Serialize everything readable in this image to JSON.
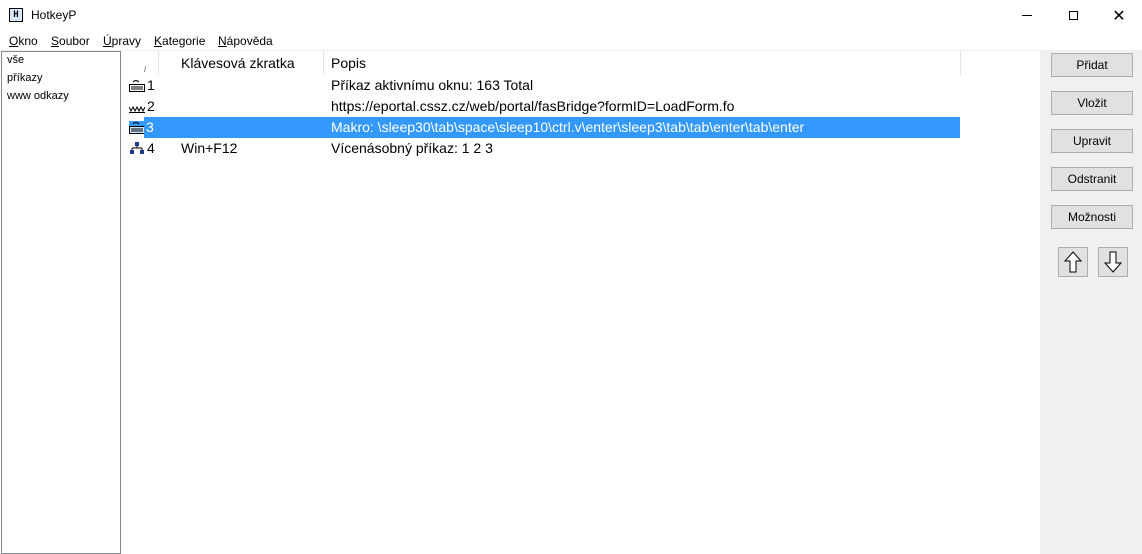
{
  "window": {
    "title": "HotkeyP"
  },
  "menu": [
    {
      "underline": "O",
      "rest": "kno"
    },
    {
      "underline": "S",
      "rest": "oubor"
    },
    {
      "underline": "Ú",
      "rest": "pravy"
    },
    {
      "underline": "K",
      "rest": "ategorie"
    },
    {
      "underline": "N",
      "rest": "ápověda"
    }
  ],
  "categories": [
    "vše",
    "příkazy",
    "www odkazy"
  ],
  "list": {
    "sort_indicator": "/",
    "columns": {
      "shortcut": "Klávesová zkratka",
      "description": "Popis"
    },
    "rows": [
      {
        "num": "1",
        "key": "",
        "desc": "Příkaz aktivnímu oknu: 163 Total",
        "icon": "keyboard-icon",
        "selected": false
      },
      {
        "num": "2",
        "key": "",
        "desc": "https://eportal.cssz.cz/web/portal/fasBridge?formID=LoadForm.fo",
        "icon": "www-icon",
        "selected": false
      },
      {
        "num": "3",
        "key": "",
        "desc": "Makro: \\sleep30\\tab\\space\\sleep10\\ctrl.v\\enter\\sleep3\\tab\\tab\\enter\\tab\\enter",
        "icon": "keyboard-icon",
        "selected": true
      },
      {
        "num": "4",
        "key": "Win+F12",
        "desc": "Vícenásobný příkaz: 1 2 3",
        "icon": "multi-command-icon",
        "selected": false
      }
    ]
  },
  "buttons": {
    "add": "Přidat",
    "insert": "Vložit",
    "edit": "Upravit",
    "delete": "Odstranit",
    "options": "Možnosti"
  },
  "colors": {
    "selection": "#3399ff",
    "panel": "#f0f0f0"
  }
}
